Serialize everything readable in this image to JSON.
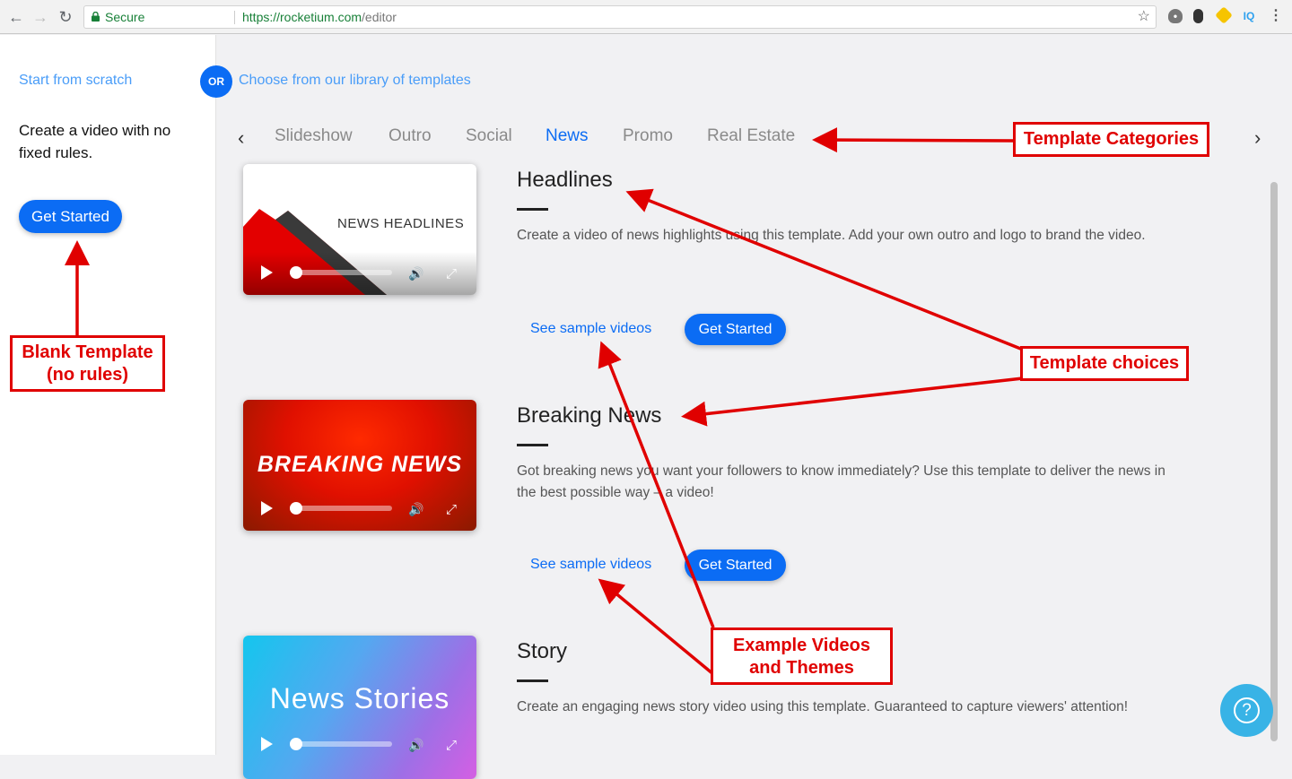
{
  "browser": {
    "secure_label": "Secure",
    "url_base": "https://rocketium.com",
    "url_path": "/editor",
    "back_icon": "arrow-left-icon",
    "forward_icon": "arrow-right-icon",
    "reload_icon": "reload-icon",
    "star_icon": "star-icon",
    "extensions": [
      "shield-extension-icon",
      "mouse-extension-icon",
      "honey-extension-icon",
      "IQ"
    ],
    "menu_icon": "kebab-menu-icon"
  },
  "left_panel": {
    "scratch_link": "Start from scratch",
    "description": "Create a video with no fixed rules.",
    "get_started": "Get Started"
  },
  "header": {
    "or_label": "OR",
    "library_link": "Choose from our library of templates"
  },
  "tabs": {
    "items": [
      "Slideshow",
      "Outro",
      "Social",
      "News",
      "Promo",
      "Real Estate"
    ],
    "active": "News"
  },
  "templates": [
    {
      "title": "Headlines",
      "thumb_text": "NEWS HEADLINES",
      "description": "Create a video of news highlights using this template. Add your own outro and logo to brand the video.",
      "sample_link": "See sample videos",
      "button": "Get Started"
    },
    {
      "title": "Breaking News",
      "thumb_text": "BREAKING NEWS",
      "description": "Got breaking news you want your followers to know immediately? Use this template to deliver the news in the best possible way – a video!",
      "sample_link": "See sample videos",
      "button": "Get Started"
    },
    {
      "title": "Story",
      "thumb_text": "News Stories",
      "description": "Create an engaging news story video using this template. Guaranteed to capture viewers' attention!"
    }
  ],
  "annotations": {
    "categories": "Template Categories",
    "blank_line1": "Blank Template",
    "blank_line2": "(no rules)",
    "choices": "Template choices",
    "examples_line1": "Example Videos",
    "examples_line2": "and Themes"
  },
  "colors": {
    "accent": "#0b6cf4",
    "link_light": "#4a9df8",
    "annotation": "#e00000",
    "help_bubble": "#38b3e6"
  }
}
